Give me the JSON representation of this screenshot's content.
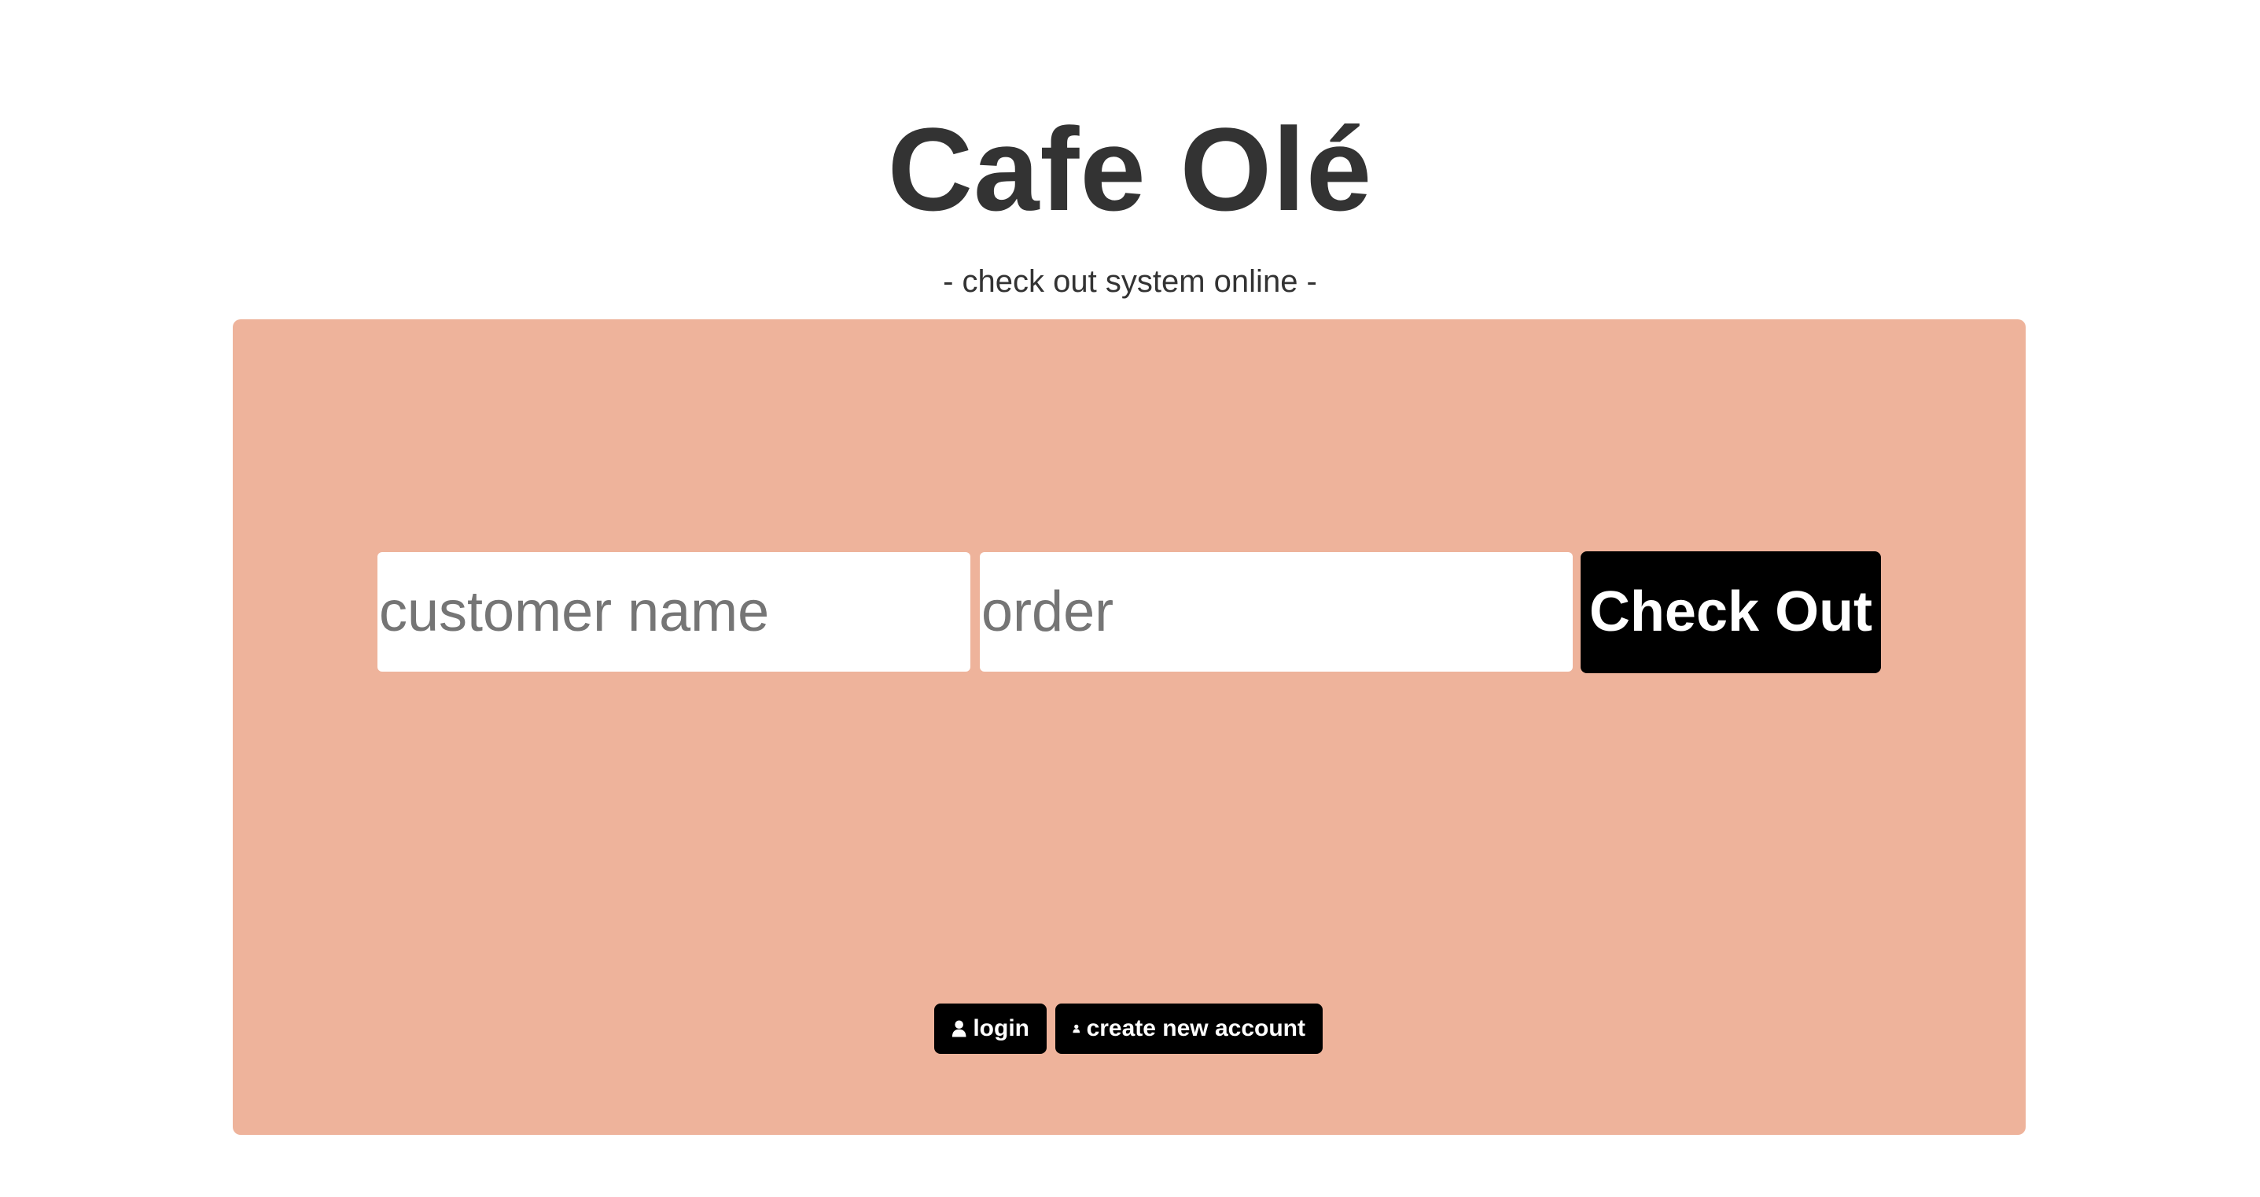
{
  "header": {
    "title": "Cafe Olé",
    "subtitle": "- check out system online -"
  },
  "form": {
    "customer_name_placeholder": "customer name",
    "customer_name_value": "",
    "order_placeholder": "order",
    "order_value": "",
    "checkout_label": "Check Out"
  },
  "account": {
    "login_label": "login",
    "create_label": "create new account",
    "icon": "user-icon"
  },
  "colors": {
    "panel": "#eeb39b",
    "button": "#000000",
    "text": "#333333"
  }
}
